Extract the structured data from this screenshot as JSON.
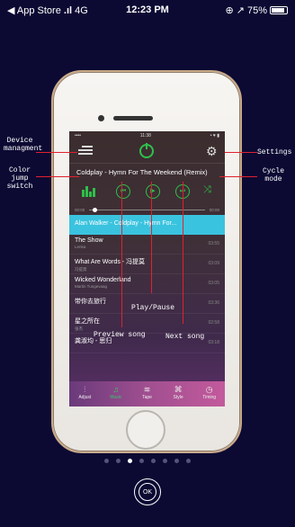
{
  "status": {
    "carrier": "◀ App Store",
    "network": "4G",
    "time": "12:23 PM",
    "battery": "75%"
  },
  "phone_status": {
    "left": "•••• ",
    "time": "11:38",
    "right": "• ♥ ▮"
  },
  "player": {
    "song_title": "Coldplay - Hymn For The Weekend (Remix)",
    "time_elapsed": "00:00",
    "time_total": "00:00",
    "highlight_row": "Alan Walker - Coldplay - Hymn For..."
  },
  "songs": [
    {
      "name": "The Show",
      "artist": "Lenka",
      "duration": "03:55"
    },
    {
      "name": "What Are Words - 冯提莫",
      "artist": "冯提莫",
      "duration": "03:09"
    },
    {
      "name": "Wicked Wonderland",
      "artist": "Martin Tungevaag",
      "duration": "03:05"
    },
    {
      "name": "带你去旅行",
      "artist": "",
      "duration": "03:36"
    },
    {
      "name": "星之所在",
      "artist": "张杰",
      "duration": "02:58"
    },
    {
      "name": "龚淑均 - 思归",
      "artist": "",
      "duration": "03:18"
    }
  ],
  "tabs": [
    {
      "label": "Adjust",
      "icon": "adjust-icon",
      "glyph": "⫶"
    },
    {
      "label": "Music",
      "icon": "music-icon",
      "glyph": "♫"
    },
    {
      "label": "Tape",
      "icon": "tape-icon",
      "glyph": "≋"
    },
    {
      "label": "Style",
      "icon": "style-icon",
      "glyph": "⌘"
    },
    {
      "label": "Timing",
      "icon": "timing-icon",
      "glyph": "◷"
    }
  ],
  "annotations": {
    "device": "Device\nmanagment",
    "settings": "Settings",
    "color": "Color\njump\nswitch",
    "cycle": "Cycle\nmode",
    "play": "Play/Pause",
    "preview": "Preview song",
    "next": "Next song"
  },
  "pager": {
    "count": 8,
    "active": 2
  },
  "ok_label": "OK",
  "colors": {
    "accent": "#2ec04a",
    "highlight": "#3ac3df",
    "annotation_line": "#e0212e",
    "background": "#0c0a33"
  }
}
